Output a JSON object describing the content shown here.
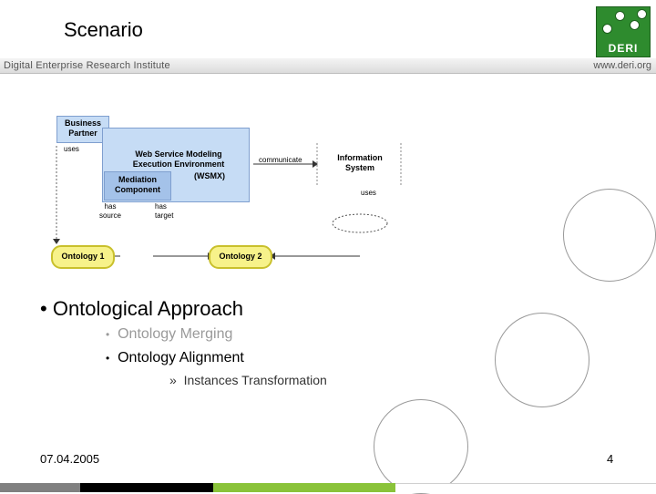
{
  "slide": {
    "title": "Scenario",
    "header_left": "Digital Enterprise Research Institute",
    "header_right": "www.deri.org",
    "logo_text": "DERI"
  },
  "diagram": {
    "business_partner": "Business Partner",
    "uses_1": "uses",
    "wsmx_title": "Web Service Modeling Execution Environment",
    "wsmx_abbr": "(WSMX)",
    "mediation": "Mediation Component",
    "communicate": "communicate",
    "info_system": "Information System",
    "uses_2": "uses",
    "has_source": "has source",
    "has_target": "has target",
    "ontology1": "Ontology 1",
    "ontology2": "Ontology 2"
  },
  "bullets": {
    "level1": "Ontological Approach",
    "level2": [
      "Ontology Merging",
      "Ontology Alignment"
    ],
    "level2_colors": [
      "#9a9a9a",
      "#000000"
    ],
    "level3": "Instances Transformation"
  },
  "footer": {
    "date": "07.04.2005",
    "page": "4"
  },
  "colors": {
    "accent_green": "#8ac33a",
    "logo_green": "#2e8b2e",
    "ontology_fill": "#f7f28a",
    "box_fill": "#c6dcf5",
    "box_fill_dark": "#a4c2e9"
  }
}
